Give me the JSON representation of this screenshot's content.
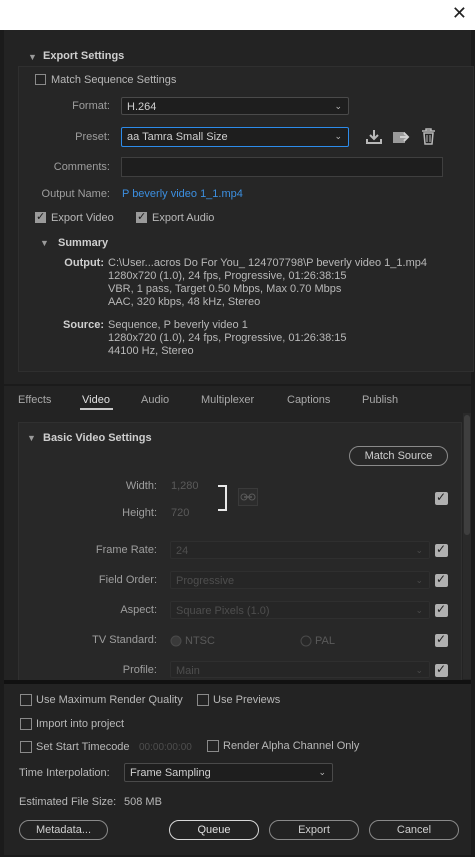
{
  "window": {
    "close_glyph": "✕"
  },
  "export": {
    "title": "Export Settings",
    "match_sequence_label": "Match Sequence Settings",
    "format_label": "Format:",
    "format_value": "H.264",
    "preset_label": "Preset:",
    "preset_value": "aa Tamra Small Size",
    "comments_label": "Comments:",
    "comments_value": "",
    "output_name_label": "Output Name:",
    "output_name_value": "P beverly video 1_1.mp4",
    "export_video_label": "Export Video",
    "export_audio_label": "Export Audio",
    "export_video_checked": true,
    "export_audio_checked": true,
    "match_sequence_checked": false
  },
  "summary": {
    "title": "Summary",
    "output_label": "Output:",
    "output_lines": [
      "C:\\User...acros Do For You_ 124707798\\P beverly video 1_1.mp4",
      "1280x720 (1.0), 24 fps, Progressive, 01:26:38:15",
      "VBR, 1 pass, Target 0.50 Mbps, Max 0.70 Mbps",
      "AAC, 320 kbps, 48 kHz, Stereo"
    ],
    "source_label": "Source:",
    "source_lines": [
      "Sequence, P beverly video 1",
      "1280x720 (1.0), 24 fps, Progressive, 01:26:38:15",
      "44100 Hz, Stereo"
    ]
  },
  "tabs": [
    "Effects",
    "Video",
    "Audio",
    "Multiplexer",
    "Captions",
    "Publish"
  ],
  "active_tab": "Video",
  "video": {
    "section_title": "Basic Video Settings",
    "match_source_label": "Match Source",
    "width_label": "Width:",
    "width_value": "1,280",
    "height_label": "Height:",
    "height_value": "720",
    "frame_rate_label": "Frame Rate:",
    "frame_rate_value": "24",
    "field_order_label": "Field Order:",
    "field_order_value": "Progressive",
    "aspect_label": "Aspect:",
    "aspect_value": "Square Pixels (1.0)",
    "tv_standard_label": "TV Standard:",
    "ntsc_label": "NTSC",
    "pal_label": "PAL",
    "profile_label": "Profile:",
    "profile_value": "Main"
  },
  "bottom": {
    "max_render_label": "Use Maximum Render Quality",
    "previews_label": "Use Previews",
    "import_label": "Import into project",
    "start_timecode_label": "Set Start Timecode",
    "start_timecode_value": "00:00:00:00",
    "render_alpha_label": "Render Alpha Channel Only",
    "time_interp_label": "Time Interpolation:",
    "time_interp_value": "Frame Sampling",
    "file_size_label": "Estimated File Size:",
    "file_size_value": "508 MB",
    "metadata_button": "Metadata...",
    "queue_button": "Queue",
    "export_button": "Export",
    "cancel_button": "Cancel"
  },
  "colors": {
    "accent": "#2d8ceb",
    "link": "#3c8fe0",
    "background": "#1b1b1b"
  }
}
